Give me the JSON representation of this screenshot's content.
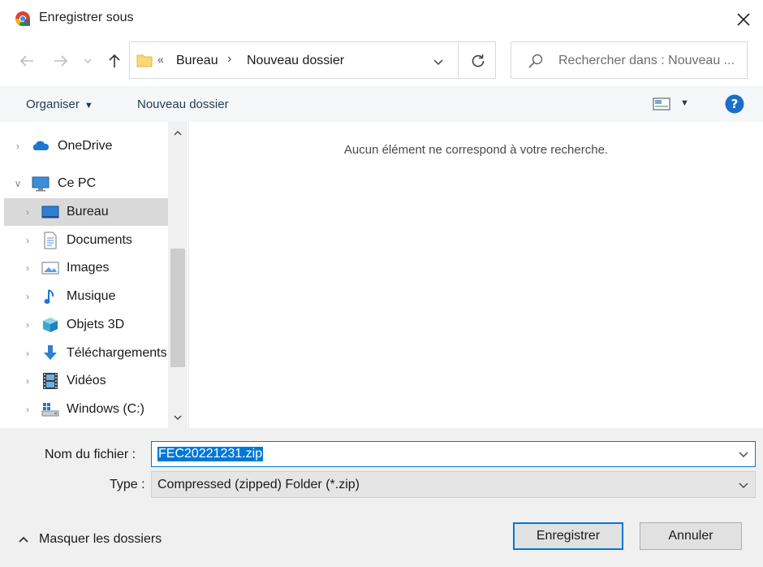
{
  "window": {
    "title": "Enregistrer sous",
    "icon": "chrome-icon",
    "close_icon": "close-icon"
  },
  "nav": {
    "back_icon": "arrow-left-icon",
    "forward_icon": "arrow-right-icon",
    "recent_icon": "chevron-down-icon",
    "up_icon": "arrow-up-icon",
    "breadcrumb_overflow": "«",
    "breadcrumbs": [
      "Bureau",
      "Nouveau dossier"
    ],
    "separator": "›",
    "refresh_icon": "refresh-icon",
    "search_placeholder": "Rechercher dans : Nouveau ..."
  },
  "toolbar": {
    "organiser_label": "Organiser",
    "new_folder_label": "Nouveau dossier",
    "view_icon": "view-options-icon",
    "help_icon": "help-icon"
  },
  "sidebar": {
    "items": [
      {
        "label": "OneDrive",
        "icon": "onedrive-icon",
        "expander": "›"
      },
      {
        "label": "Ce PC",
        "icon": "computer-icon",
        "expander": "∨"
      },
      {
        "label": "Bureau",
        "icon": "desktop-icon",
        "expander": "›"
      },
      {
        "label": "Documents",
        "icon": "documents-icon",
        "expander": "›"
      },
      {
        "label": "Images",
        "icon": "pictures-icon",
        "expander": "›"
      },
      {
        "label": "Musique",
        "icon": "music-icon",
        "expander": "›"
      },
      {
        "label": "Objets 3D",
        "icon": "objects-3d-icon",
        "expander": "›"
      },
      {
        "label": "Téléchargements",
        "icon": "downloads-icon",
        "expander": "›"
      },
      {
        "label": "Vidéos",
        "icon": "videos-icon",
        "expander": "›"
      },
      {
        "label": "Windows (C:)",
        "icon": "drive-icon",
        "expander": "›"
      }
    ],
    "selected": "Bureau"
  },
  "content": {
    "empty_message": "Aucun élément ne correspond à votre recherche."
  },
  "form": {
    "filename_label": "Nom du fichier :",
    "filename_value": "FEC20221231.zip",
    "type_label": "Type :",
    "type_value": "Compressed (zipped) Folder (*.zip)"
  },
  "footer": {
    "hide_folders_label": "Masquer les dossiers",
    "save_label": "Enregistrer",
    "cancel_label": "Annuler"
  },
  "colors": {
    "accent": "#0078d7",
    "selection": "#d9d9d9",
    "folder": "#f8d775"
  }
}
